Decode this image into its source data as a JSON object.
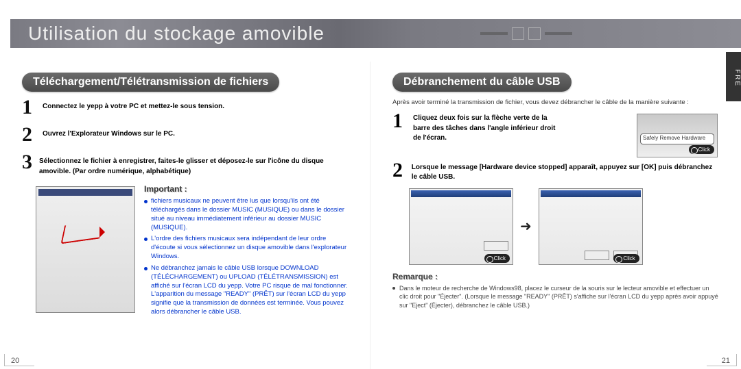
{
  "banner": {
    "title": "Utilisation du stockage amovible"
  },
  "tab": {
    "label": "FRE"
  },
  "left": {
    "heading": "Téléchargement/Télétransmission de fichiers",
    "steps": [
      "Connectez le yepp à votre PC et mettez-le sous tension.",
      "Ouvrez l'Explorateur Windows sur le PC.",
      "Sélectionnez le fichier à enregistrer, faites-le glisser et déposez-le sur l'icône du disque amovible. (Par ordre numérique, alphabétique)"
    ],
    "important": {
      "heading": "Important :",
      "items": [
        "fichiers musicaux ne peuvent être lus que lorsqu'ils ont été téléchargés dans le dossier MUSIC (MUSIQUE) ou dans le dossier situé au niveau immédiatement inférieur au dossier MUSIC (MUSIQUE).",
        "L'ordre des fichiers musicaux sera indépendant de leur ordre d'écoute si vous sélectionnez un disque amovible dans l'explorateur Windows.",
        "Ne débranchez jamais le câble USB lorsque DOWNLOAD (TÉLÉCHARGEMENT) ou UPLOAD (TÉLÉTRANSMISSION) est affiché sur l'écran LCD du yepp. Votre PC risque de mal fonctionner. L'apparition du message \"READY\" (PRÊT) sur l'écran LCD du yepp signifie que la transmission de données est terminée. Vous pouvez alors débrancher le câble USB."
      ]
    },
    "page_num": "20"
  },
  "right": {
    "heading": "Débranchement du câble USB",
    "intro": "Après avoir terminé la transmission de fichier, vous devez débrancher le câble de la manière suivante :",
    "step1": "Cliquez deux fois sur la flèche verte de la barre des tâches dans l'angle inférieur droit de l'écran.",
    "step2": "Lorsque le message [Hardware device stopped] apparaît, appuyez sur [OK] puis débranchez le câble USB.",
    "tray_tooltip": "Safely Remove Hardware",
    "click_label": "Click",
    "remarque": {
      "heading": "Remarque :",
      "items": [
        "Dans le moteur de recherche de Windows98, placez le curseur de la souris sur le lecteur amovible et effectuer un clic droit pour \"Éjecter\". (Lorsque le message \"READY\" (PRÊT) s'affiche sur l'écran LCD du yepp après avoir appuyé sur \"Eject\" (Éjecter), débranchez le câble USB.)"
      ]
    },
    "page_num": "21"
  }
}
